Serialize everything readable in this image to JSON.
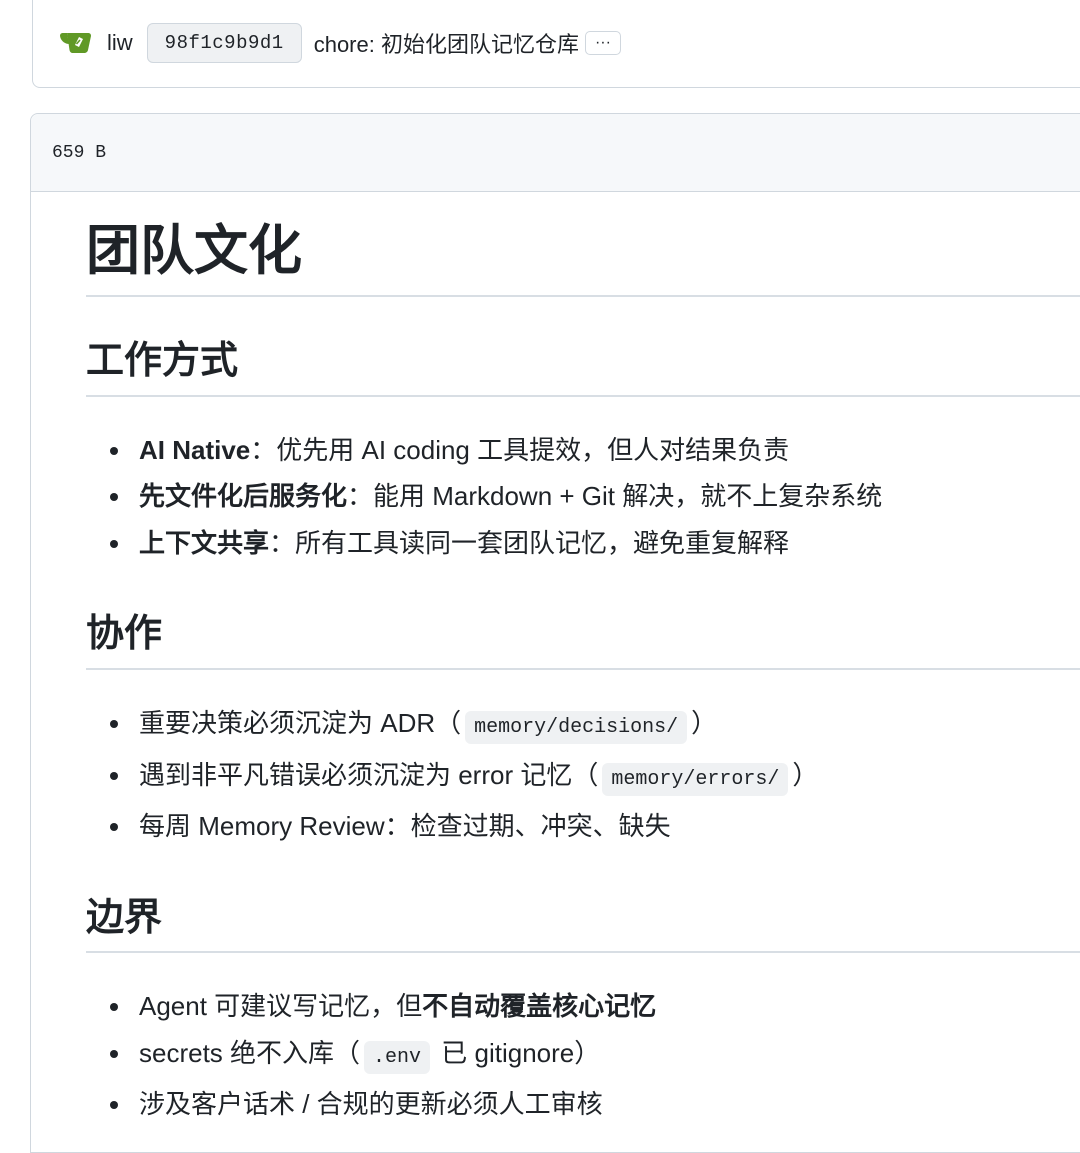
{
  "commit": {
    "author": "liw",
    "sha": "98f1c9b9d1",
    "message": "chore: 初始化团队记忆仓库",
    "more_label": "···",
    "avatar_icon": "gitea-logo-icon",
    "avatar_color": "#609926"
  },
  "file": {
    "size": "659 B"
  },
  "doc": {
    "title": "团队文化",
    "sections": [
      {
        "heading": "工作方式",
        "items": [
          {
            "bold": "AI Native",
            "text": "：优先用 AI coding 工具提效，但人对结果负责"
          },
          {
            "bold": "先文件化后服务化",
            "text": "：能用 Markdown + Git 解决，就不上复杂系统"
          },
          {
            "bold": "上下文共享",
            "text": "：所有工具读同一套团队记忆，避免重复解释"
          }
        ]
      },
      {
        "heading": "协作",
        "items": [
          {
            "pre": "重要决策必须沉淀为 ADR（",
            "code": "memory/decisions/",
            "post": "）"
          },
          {
            "pre": "遇到非平凡错误必须沉淀为 error 记忆（",
            "code": "memory/errors/",
            "post": "）"
          },
          {
            "pre": "每周 Memory Review：检查过期、冲突、缺失"
          }
        ]
      },
      {
        "heading": "边界",
        "items": [
          {
            "pre": "Agent 可建议写记忆，但",
            "bold": "不自动覆盖核心记忆"
          },
          {
            "pre": "secrets 绝不入库（",
            "code": ".env",
            "post": " 已 gitignore）"
          },
          {
            "pre": "涉及客户话术 / 合规的更新必须人工审核"
          }
        ]
      }
    ]
  }
}
